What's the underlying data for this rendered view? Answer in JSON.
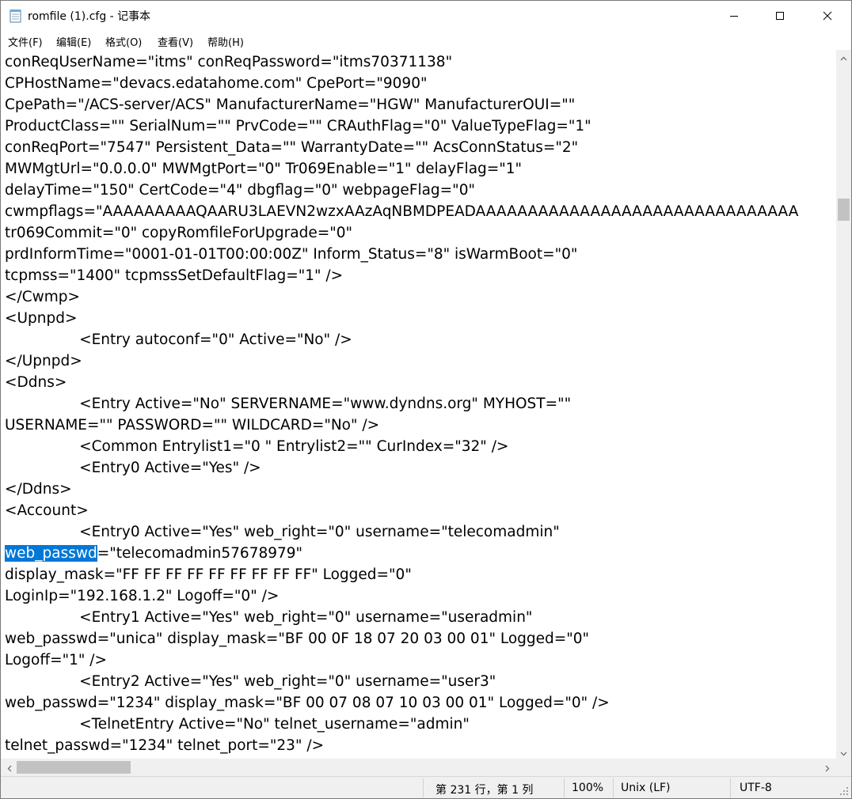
{
  "window": {
    "title": "romfile (1).cfg - 记事本",
    "icons": {
      "app": "notepad-icon",
      "minimize": "minimize-icon",
      "maximize": "maximize-icon",
      "close": "close-icon"
    }
  },
  "menu": {
    "items": [
      {
        "label": "文件(F)"
      },
      {
        "label": "编辑(E)"
      },
      {
        "label": "格式(O)"
      },
      {
        "label": "查看(V)"
      },
      {
        "label": "帮助(H)"
      }
    ]
  },
  "editor": {
    "lines": [
      "conReqUserName=\"itms\" conReqPassword=\"itms70371138\"",
      "CPHostName=\"devacs.edatahome.com\" CpePort=\"9090\"",
      "CpePath=\"/ACS-server/ACS\" ManufacturerName=\"HGW\" ManufacturerOUI=\"\"",
      "ProductClass=\"\" SerialNum=\"\" PrvCode=\"\" CRAuthFlag=\"0\" ValueTypeFlag=\"1\"",
      "conReqPort=\"7547\" Persistent_Data=\"\" WarrantyDate=\"\" AcsConnStatus=\"2\"",
      "MWMgtUrl=\"0.0.0.0\" MWMgtPort=\"0\" Tr069Enable=\"1\" delayFlag=\"1\"",
      "delayTime=\"150\" CertCode=\"4\" dbgflag=\"0\" webpageFlag=\"0\"",
      "cwmpflags=\"AAAAAAAAAQAARU3LAEVN2wzxAAzAqNBMDPEADAAAAAAAAAAAAAAAAAAAAAAAAAAAAAAA",
      "tr069Commit=\"0\" copyRomfileForUpgrade=\"0\"",
      "prdInformTime=\"0001-01-01T00:00:00Z\" Inform_Status=\"8\" isWarmBoot=\"0\"",
      "tcpmss=\"1400\" tcpmssSetDefaultFlag=\"1\" />",
      "</Cwmp>",
      "<Upnpd>",
      "\t<Entry autoconf=\"0\" Active=\"No\" />",
      "</Upnpd>",
      "<Ddns>",
      "\t<Entry Active=\"No\" SERVERNAME=\"www.dyndns.org\" MYHOST=\"\"",
      "USERNAME=\"\" PASSWORD=\"\" WILDCARD=\"No\" />",
      "\t<Common Entrylist1=\"0 \" Entrylist2=\"\" CurIndex=\"32\" />",
      "\t<Entry0 Active=\"Yes\" />",
      "</Ddns>",
      "<Account>",
      "\t<Entry0 Active=\"Yes\" web_right=\"0\" username=\"telecomadmin\"",
      "SELECTED_LINE",
      "display_mask=\"FF FF FF FF FF FF FF FF FF\" Logged=\"0\"",
      "LoginIp=\"192.168.1.2\" Logoff=\"0\" />",
      "\t<Entry1 Active=\"Yes\" web_right=\"0\" username=\"useradmin\"",
      "web_passwd=\"unica\" display_mask=\"BF 00 0F 18 07 20 03 00 01\" Logged=\"0\"",
      "Logoff=\"1\" />",
      "\t<Entry2 Active=\"Yes\" web_right=\"0\" username=\"user3\"",
      "web_passwd=\"1234\" display_mask=\"BF 00 07 08 07 10 03 00 01\" Logged=\"0\" />",
      "\t<TelnetEntry Active=\"No\" telnet_username=\"admin\"",
      "telnet_passwd=\"1234\" telnet_port=\"23\" />"
    ],
    "selected": {
      "text": "web_passwd",
      "rest": "=\"telecomadmin57678979\""
    }
  },
  "status": {
    "position": "第 231 行，第 1 列",
    "zoom": "100%",
    "line_ending": "Unix (LF)",
    "encoding": "UTF-8"
  },
  "colors": {
    "selection": "#0078d7",
    "chrome": "#f0f0f0"
  }
}
